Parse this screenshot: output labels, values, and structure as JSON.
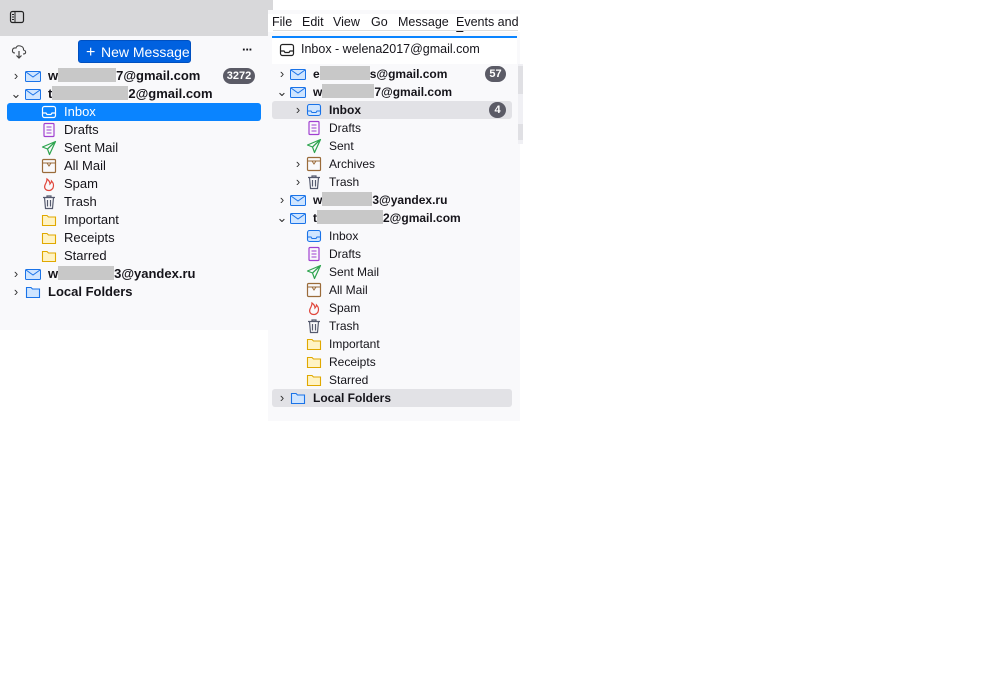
{
  "left": {
    "new_message": "New Message",
    "more": "···",
    "accounts": [
      {
        "name_prefix": "w",
        "name_suffix": "7@gmail.com",
        "badge": "3272",
        "expanded": false
      },
      {
        "name_prefix": "t",
        "name_suffix": "2@gmail.com",
        "expanded": true
      },
      {
        "name_prefix": "w",
        "name_suffix": "3@yandex.ru",
        "expanded": false
      },
      {
        "name": "Local Folders",
        "expanded": false
      }
    ],
    "folders": [
      "Inbox",
      "Drafts",
      "Sent Mail",
      "All Mail",
      "Spam",
      "Trash",
      "Important",
      "Receipts",
      "Starred"
    ]
  },
  "menu": {
    "file": "File",
    "edit": "Edit",
    "view": "View",
    "go": "Go",
    "message": "Message",
    "events": "Events and Ta"
  },
  "right": {
    "tab_title": "Inbox - welena2017@gmail.com",
    "accounts": [
      {
        "name_prefix": "e",
        "name_suffix": "s@gmail.com",
        "badge": "57"
      },
      {
        "name_prefix": "w",
        "name_suffix": "7@gmail.com"
      },
      {
        "name_prefix": "w",
        "name_suffix": "3@yandex.ru"
      },
      {
        "name_prefix": "t",
        "name_suffix": "2@gmail.com"
      },
      {
        "name": "Local Folders"
      }
    ],
    "account1_folders": [
      {
        "label": "Inbox",
        "badge": "4",
        "bold": true
      },
      {
        "label": "Drafts"
      },
      {
        "label": "Sent"
      },
      {
        "label": "Archives"
      },
      {
        "label": "Trash"
      }
    ],
    "account3_folders": [
      "Inbox",
      "Drafts",
      "Sent Mail",
      "All Mail",
      "Spam",
      "Trash",
      "Important",
      "Receipts",
      "Starred"
    ]
  },
  "colors": {
    "accent": "#0061e0",
    "selection": "#0a84ff",
    "badge": "#5b5b66"
  }
}
